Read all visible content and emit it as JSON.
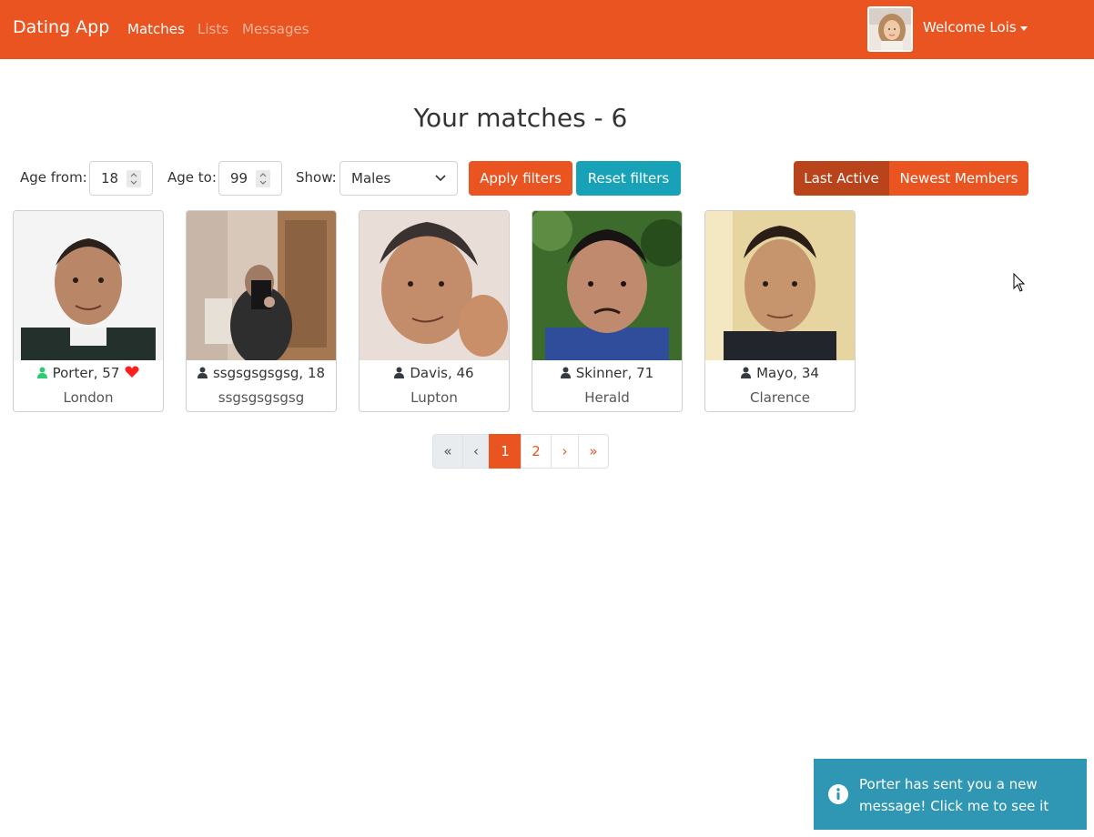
{
  "navbar": {
    "brand": "Dating App",
    "links": [
      "Matches",
      "Lists",
      "Messages"
    ],
    "welcome": "Welcome Lois",
    "color": "#e95420"
  },
  "title": "Your matches - 6",
  "filters": {
    "age_from_label": "Age from:",
    "age_from_value": "18",
    "age_to_label": "Age to:",
    "age_to_value": "99",
    "show_label": "Show:",
    "show_value": "Males",
    "apply_label": "Apply filters",
    "reset_label": "Reset filters",
    "sort": [
      "Last Active",
      "Newest Members"
    ]
  },
  "members": [
    {
      "name": "Porter, 57",
      "city": "London",
      "online": true,
      "liked": true
    },
    {
      "name": "ssgsgsgsgsg, 18",
      "city": "ssgsgsgsgsg",
      "online": false,
      "liked": false
    },
    {
      "name": "Davis, 46",
      "city": "Lupton",
      "online": false,
      "liked": false
    },
    {
      "name": "Skinner, 71",
      "city": "Herald",
      "online": false,
      "liked": false
    },
    {
      "name": "Mayo, 34",
      "city": "Clarence",
      "online": false,
      "liked": false
    }
  ],
  "pagination": {
    "first": "«",
    "prev": "‹",
    "pages": [
      "1",
      "2"
    ],
    "current": "1",
    "next": "›",
    "last": "»"
  },
  "toast": {
    "message": "Porter has sent you a new message! Click me to see it",
    "color": "#2f96b4"
  },
  "icons": {
    "user": "user-icon",
    "heart": "heart-icon",
    "info": "info-circle-icon"
  }
}
